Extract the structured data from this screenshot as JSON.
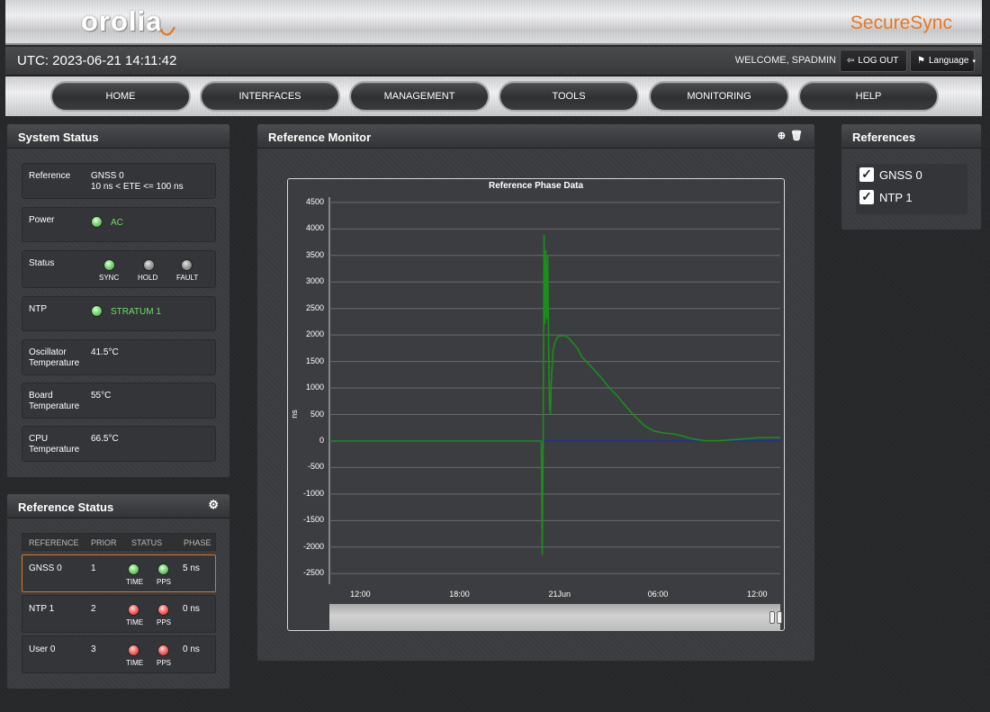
{
  "header": {
    "logo": "orolia",
    "brand": "SecureSync"
  },
  "topbar": {
    "utc": "UTC: 2023-06-21 14:11:42",
    "welcome": "WELCOME, SPADMIN",
    "logout_label": "LOG OUT",
    "language_label": "Language"
  },
  "nav": [
    "HOME",
    "INTERFACES",
    "MANAGEMENT",
    "TOOLS",
    "MONITORING",
    "HELP"
  ],
  "system_status": {
    "title": "System Status",
    "reference_label": "Reference",
    "reference_value_1": "GNSS 0",
    "reference_value_2": "10 ns < ETE <= 100 ns",
    "power_label": "Power",
    "power_value": "AC",
    "status_label": "Status",
    "status_leds": [
      "SYNC",
      "HOLD",
      "FAULT"
    ],
    "ntp_label": "NTP",
    "ntp_value": "STRATUM 1",
    "osc_label_1": "Oscillator",
    "osc_label_2": "Temperature",
    "osc_value": "41.5°C",
    "board_label_1": "Board",
    "board_label_2": "Temperature",
    "board_value": "55°C",
    "cpu_label_1": "CPU",
    "cpu_label_2": "Temperature",
    "cpu_value": "66.5°C"
  },
  "reference_status": {
    "title": "Reference Status",
    "columns": [
      "REFERENCE",
      "PRIOR",
      "STATUS",
      "PHASE"
    ],
    "rows": [
      {
        "reference": "GNSS 0",
        "prior": "1",
        "time": "TIME",
        "pps": "PPS",
        "phase": "5 ns",
        "state": "green"
      },
      {
        "reference": "NTP 1",
        "prior": "2",
        "time": "TIME",
        "pps": "PPS",
        "phase": "0 ns",
        "state": "red"
      },
      {
        "reference": "User 0",
        "prior": "3",
        "time": "TIME",
        "pps": "PPS",
        "phase": "0 ns",
        "state": "red"
      }
    ]
  },
  "reference_monitor": {
    "title": "Reference Monitor"
  },
  "references": {
    "title": "References",
    "items": [
      {
        "label": "GNSS 0",
        "checked": true
      },
      {
        "label": "NTP 1",
        "checked": true
      }
    ]
  },
  "chart_data": {
    "type": "line",
    "title": "Reference Phase Data",
    "ylabel": "ns",
    "xlabel": "",
    "ylim": [
      -2700,
      4600
    ],
    "yticks": [
      4500,
      4000,
      3500,
      3000,
      2500,
      2000,
      1500,
      1000,
      500,
      0,
      -500,
      -1000,
      -1500,
      -2000,
      -2500
    ],
    "xticks": [
      "12:00",
      "18:00",
      "21Jun",
      "06:00",
      "12:00"
    ],
    "grid": true,
    "series": [
      {
        "color": "#1a8f1a",
        "x": [
          0.0,
          0.47,
          0.472,
          0.474,
          0.476,
          0.478,
          0.48,
          0.482,
          0.484,
          0.486,
          0.488,
          0.49,
          0.492,
          0.494,
          0.496,
          0.5,
          0.505,
          0.51,
          0.52,
          0.53,
          0.54,
          0.55,
          0.56,
          0.58,
          0.6,
          0.62,
          0.64,
          0.66,
          0.68,
          0.7,
          0.72,
          0.74,
          0.76,
          0.78,
          0.8,
          0.83,
          0.86,
          0.9,
          0.95,
          1.0
        ],
        "y": [
          0,
          0,
          -2150,
          0,
          3900,
          2200,
          3600,
          2300,
          3500,
          2000,
          700,
          500,
          1100,
          1400,
          1700,
          1850,
          1950,
          1980,
          1990,
          1950,
          1850,
          1750,
          1600,
          1450,
          1250,
          1000,
          800,
          600,
          450,
          320,
          220,
          150,
          100,
          70,
          50,
          40,
          40,
          30,
          30,
          30
        ]
      },
      {
        "color": "#1d2fa8",
        "x": [
          0.0,
          1.0
        ],
        "y": [
          0,
          0
        ]
      }
    ]
  },
  "colors": {
    "accent": "#e87722",
    "ok": "#6fdc6a",
    "selected_row": "#d07a2a"
  }
}
